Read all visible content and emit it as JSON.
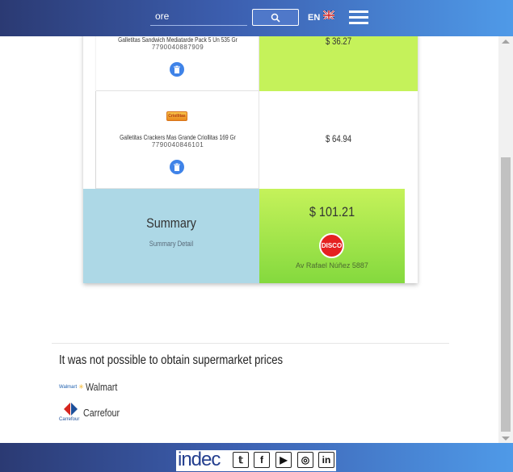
{
  "header": {
    "search_value": "ore",
    "language": "EN"
  },
  "products": [
    {
      "name": "Galletitas Sandwich Mediatarde Pack 5 Un 535 Gr",
      "code": "7790040887909",
      "price": "$ 36.27"
    },
    {
      "name": "Galletitas Crackers Mas Grande Criollitas 169 Gr",
      "code": "7790040846101",
      "price": "$ 64.94",
      "image_label": "Criollitas"
    }
  ],
  "summary": {
    "title": "Summary",
    "detail": "Summary Detail",
    "total": "$ 101.21",
    "store_logo": "DISCO",
    "store_address": "Av Rafael Núñez 5887"
  },
  "unavailable": {
    "title": "It was not possible to obtain supermarket prices",
    "stores": [
      {
        "name": "Walmart",
        "logo_text": "Walmart"
      },
      {
        "name": "Carrefour",
        "logo_text": "Carrefour"
      }
    ]
  },
  "footer": {
    "brand": "indec",
    "social": [
      "twitter-icon",
      "facebook-icon",
      "youtube-icon",
      "instagram-icon",
      "linkedin-icon"
    ]
  },
  "colors": {
    "header_start": "#2b3a73",
    "header_end": "#4f9ae8",
    "best_price_green": "#c5f25a",
    "summary_blue": "#add8e6",
    "delete_blue": "#3f83e8",
    "disco_red": "#e52121"
  }
}
